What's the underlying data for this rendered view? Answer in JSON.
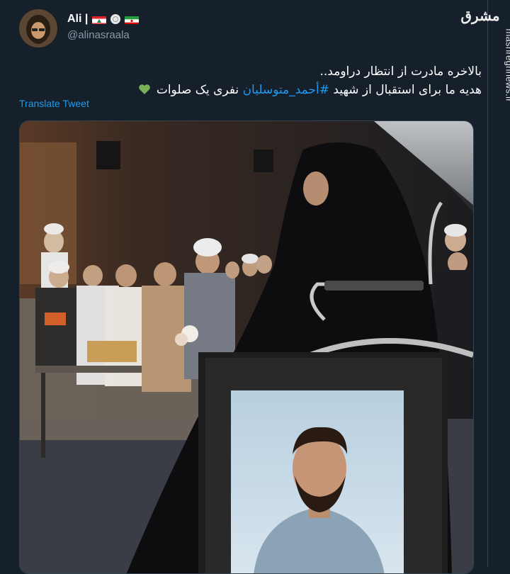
{
  "tweet": {
    "author": {
      "display_name": "Ali |",
      "handle": "@alinasraala",
      "badges": [
        "lebanon-flag-icon",
        "shell-icon",
        "iran-flag-icon"
      ]
    },
    "text_line1": "بالاخره مادرت از انتظار دراومد..",
    "text_line2_prefix": "هدیه ما برای استقبال از شهید ",
    "hashtag": "#أحمد_متوسلیان",
    "text_line2_suffix": " نفری یک صلوات",
    "emoji": "green-heart-icon",
    "translate_label": "Translate Tweet"
  },
  "watermark": {
    "logo_text": "مشرق",
    "url": "mashreghnews.ir"
  },
  "colors": {
    "background": "#15202b",
    "link": "#1d9bf0",
    "secondary_text": "#8899a6",
    "divider": "#38444d"
  }
}
